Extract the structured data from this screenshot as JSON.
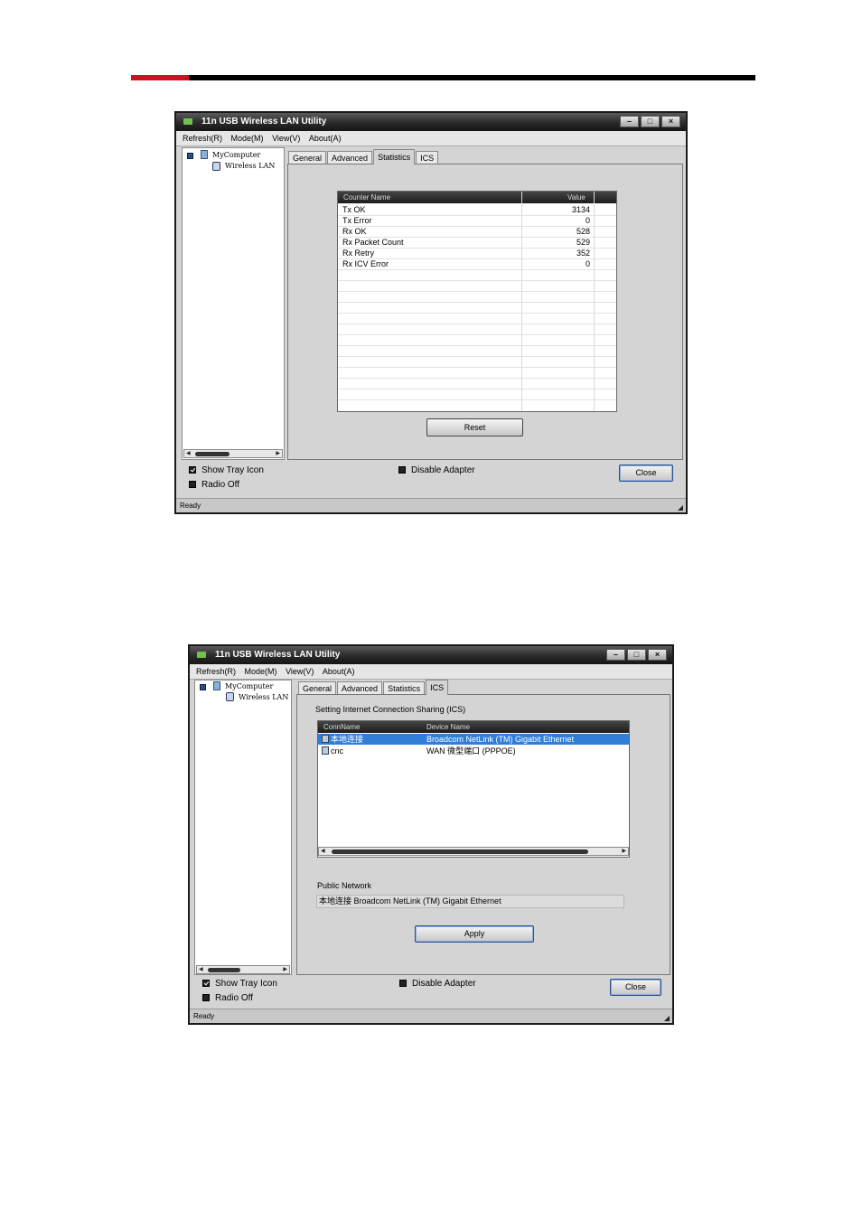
{
  "window_title": "11n USB Wireless LAN Utility",
  "menu": [
    "Refresh(R)",
    "Mode(M)",
    "View(V)",
    "About(A)"
  ],
  "window_buttons": [
    "–",
    "□",
    "×"
  ],
  "tree": {
    "root": "MyComputer",
    "child": "Wireless LAN"
  },
  "tabs": [
    "General",
    "Advanced",
    "Statistics",
    "ICS"
  ],
  "footer": {
    "show_tray_icon": "Show Tray Icon",
    "radio_off": "Radio Off",
    "disable_adapter": "Disable Adapter",
    "close": "Close",
    "status": "Ready"
  },
  "statistics": {
    "headers": [
      "Counter Name",
      "Value"
    ],
    "rows": [
      {
        "name": "Tx OK",
        "value": "3134"
      },
      {
        "name": "Tx Error",
        "value": "0"
      },
      {
        "name": "Rx OK",
        "value": "528"
      },
      {
        "name": "Rx Packet Count",
        "value": "529"
      },
      {
        "name": "Rx Retry",
        "value": "352"
      },
      {
        "name": "Rx ICV Error",
        "value": "0"
      }
    ],
    "reset": "Reset"
  },
  "ics": {
    "heading": "Setting Internet Connection Sharing (ICS)",
    "headers": [
      "ConnName",
      "Device Name"
    ],
    "rows": [
      {
        "conn": "本地连接",
        "device": "Broadcom NetLink (TM) Gigabit Ethernet"
      },
      {
        "conn": "cnc",
        "device": "WAN 微型端口 (PPPOE)"
      }
    ],
    "public_network_label": "Public Network",
    "public_network_value": "本地连接 Broadcom NetLink (TM) Gigabit Ethernet",
    "apply": "Apply"
  }
}
